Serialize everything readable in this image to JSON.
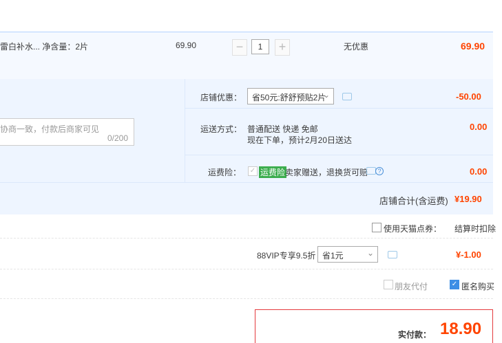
{
  "item": {
    "title": "雷白补水...  净含量：2片",
    "price": "69.90",
    "quantity": "1",
    "discount_text": "无优惠",
    "subtotal": "69.90"
  },
  "shop": {
    "message_placeholder": "协商一致，付款后商家可见",
    "message_count": "0/200",
    "coupon_label": "店铺优惠：",
    "coupon_value": "省50元:舒舒预贴2片",
    "coupon_amount": "-50.00",
    "shipping_label": "运送方式：",
    "shipping_line1": "普通配送 快递 免邮",
    "shipping_line2": "现在下单，预计2月20日送达",
    "shipping_amount": "0.00",
    "insurance_label": "运费险：",
    "insurance_tag": "运费险",
    "insurance_text": "卖家赠送，退换货可赔",
    "insurance_amount": "0.00",
    "total_label": "店铺合计(含运费)",
    "total_value": "¥19.90"
  },
  "tmall_points": {
    "label": "使用天猫点券：",
    "note": "结算时扣除"
  },
  "vip": {
    "label": "88VIP专享9.5折",
    "select_value": "省1元",
    "amount": "¥-1.00"
  },
  "options": {
    "friend_pay": "朋友代付",
    "anonymous": "匿名购买"
  },
  "payment": {
    "label": "实付款：",
    "amount": "18.90"
  },
  "colors": {
    "accent_red": "#ff4400",
    "link_blue": "#3d8ee5",
    "panel_blue": "#eef5ff"
  }
}
